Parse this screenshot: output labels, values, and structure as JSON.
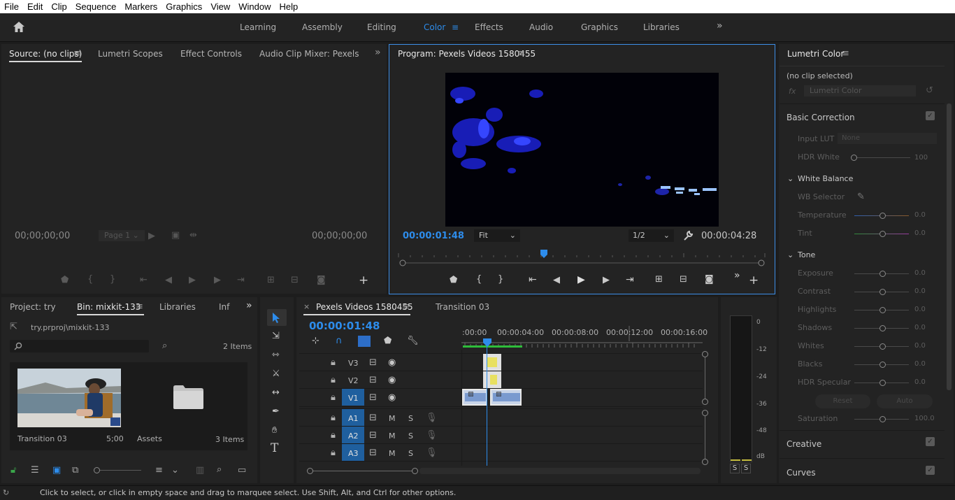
{
  "menu": [
    "File",
    "Edit",
    "Clip",
    "Sequence",
    "Markers",
    "Graphics",
    "View",
    "Window",
    "Help"
  ],
  "workspaces": {
    "tabs": [
      "Learning",
      "Assembly",
      "Editing",
      "Color",
      "Effects",
      "Audio",
      "Graphics",
      "Libraries"
    ],
    "active": "Color"
  },
  "source_panel": {
    "tabs": [
      "Source: (no clips)",
      "Lumetri Scopes",
      "Effect Controls",
      "Audio Clip Mixer: Pexels Vide"
    ],
    "timecode_left": "00;00;00;00",
    "timecode_right": "00;00;00;00",
    "page_select": "Page 1"
  },
  "program_panel": {
    "title": "Program: Pexels Videos 1580455",
    "timecode": "00:00:01:48",
    "fit": "Fit",
    "resolution": "1/2",
    "duration": "00:00:04:28"
  },
  "lumetri": {
    "title": "Lumetri Color",
    "no_clip": "(no clip selected)",
    "fx_label": "fx",
    "effect": "Lumetri Color",
    "sections": {
      "basic": "Basic Correction",
      "creative": "Creative",
      "curves": "Curves"
    },
    "input_lut": {
      "label": "Input LUT",
      "value": "None"
    },
    "hdr_white": {
      "label": "HDR White",
      "value": "100"
    },
    "white_balance": "White Balance",
    "wb_selector": "WB Selector",
    "temperature": {
      "label": "Temperature",
      "value": "0.0"
    },
    "tint": {
      "label": "Tint",
      "value": "0.0"
    },
    "tone": "Tone",
    "tone_controls": [
      {
        "label": "Exposure",
        "value": "0.0"
      },
      {
        "label": "Contrast",
        "value": "0.0"
      },
      {
        "label": "Highlights",
        "value": "0.0"
      },
      {
        "label": "Shadows",
        "value": "0.0"
      },
      {
        "label": "Whites",
        "value": "0.0"
      },
      {
        "label": "Blacks",
        "value": "0.0"
      },
      {
        "label": "HDR Specular",
        "value": "0.0"
      }
    ],
    "reset": "Reset",
    "auto": "Auto",
    "saturation": {
      "label": "Saturation",
      "value": "100.0"
    }
  },
  "project_panel": {
    "tabs": [
      "Project: try",
      "Bin: mixkit-133",
      "Libraries",
      "Info"
    ],
    "path": "try.prproj\\mixkit-133",
    "item_count": "2 Items",
    "items": [
      {
        "name": "Transition 03",
        "meta": "5;00"
      },
      {
        "name": "Assets",
        "meta": "3 Items"
      }
    ]
  },
  "timeline": {
    "tabs": [
      "Pexels Videos 1580455",
      "Transition 03"
    ],
    "timecode": "00:00:01:48",
    "ruler": [
      ":00:00",
      "00:00:04:00",
      "00:00:08:00",
      "00:00:12:00",
      "00:00:16:00"
    ],
    "video_tracks": [
      "V3",
      "V2",
      "V1"
    ],
    "audio_tracks": [
      "A1",
      "A2",
      "A3"
    ],
    "m": "M",
    "s": "S"
  },
  "meter": {
    "scale": [
      "0",
      "-12",
      "-24",
      "-36",
      "-48",
      "dB"
    ],
    "solo": [
      "S",
      "S"
    ]
  },
  "status": "Click to select, or click in empty space and drag to marquee select. Use Shift, Alt, and Ctrl for other options."
}
